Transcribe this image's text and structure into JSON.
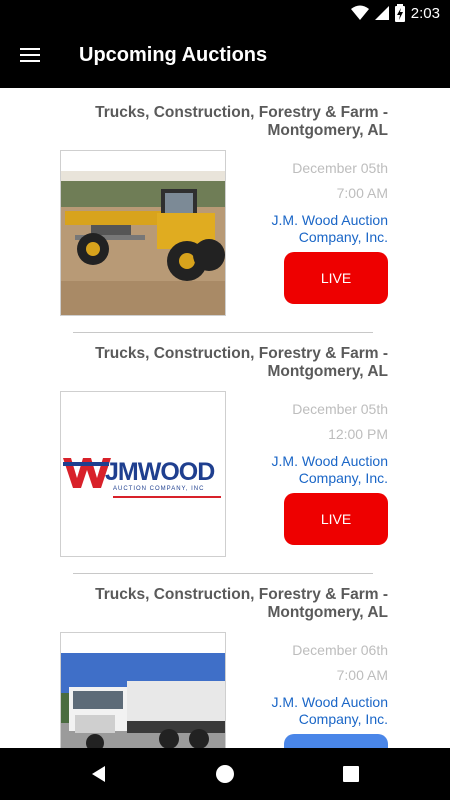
{
  "status_bar": {
    "time": "2:03"
  },
  "app_bar": {
    "title": "Upcoming Auctions"
  },
  "auctions": [
    {
      "title": "Trucks, Construction, Forestry & Farm - Montgomery, AL",
      "date": "December 05th",
      "time": "7:00 AM",
      "company": "J.M. Wood Auction Company, Inc.",
      "button": "LIVE",
      "image": "motor-grader-photo"
    },
    {
      "title": "Trucks, Construction, Forestry & Farm - Montgomery, AL",
      "date": "December 05th",
      "time": "12:00 PM",
      "company": "J.M. Wood Auction Company, Inc.",
      "button": "LIVE",
      "image": "jm-wood-logo",
      "logo_text": "JMWOOD",
      "logo_subtext": "AUCTION COMPANY, INC"
    },
    {
      "title": "Trucks, Construction, Forestry & Farm - Montgomery, AL",
      "date": "December 06th",
      "time": "7:00 AM",
      "company": "J.M. Wood Auction Company, Inc.",
      "image": "dump-truck-photo"
    }
  ],
  "colors": {
    "live": "#ee0000",
    "link": "#1a66c7",
    "bar": "#000000"
  }
}
